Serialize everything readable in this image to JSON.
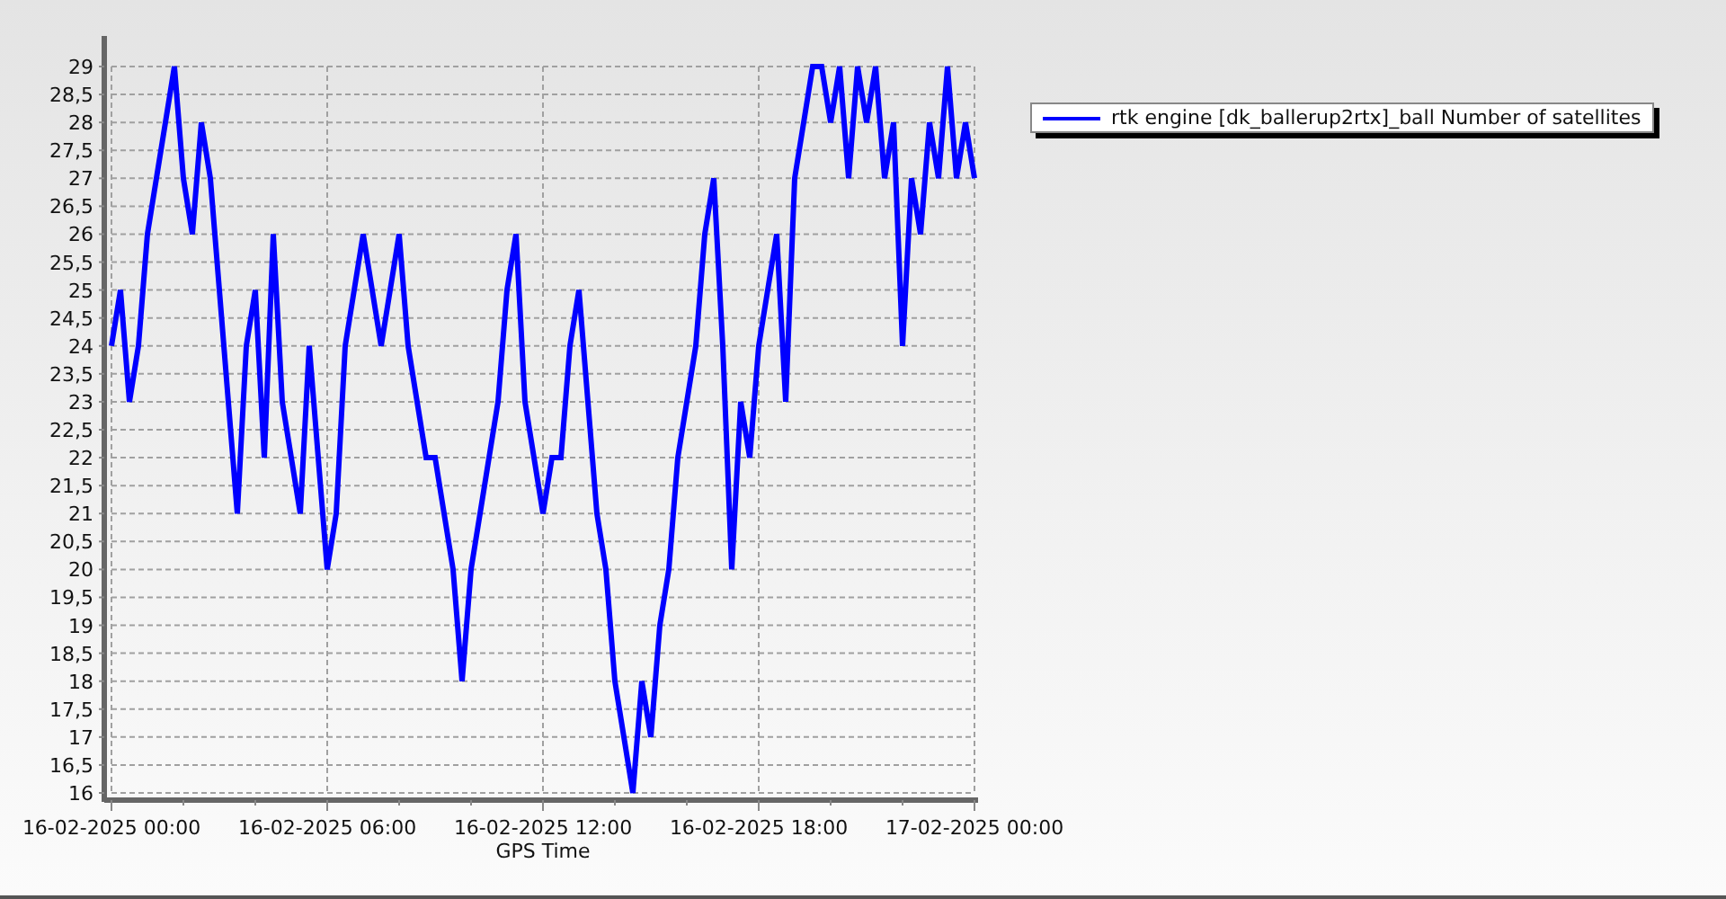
{
  "chart": {
    "chart_data": {
      "type": "line",
      "xlabel": "GPS Time",
      "ylim": [
        16,
        29
      ],
      "grid": true,
      "categories": [
        "16-02-2025 00:00",
        null,
        null,
        null,
        null,
        null,
        null,
        null,
        null,
        null,
        null,
        null,
        null,
        null,
        null,
        null,
        null,
        null,
        null,
        null,
        null,
        null,
        null,
        null,
        "16-02-2025 06:00",
        null,
        null,
        null,
        null,
        null,
        null,
        null,
        null,
        null,
        null,
        null,
        null,
        null,
        null,
        null,
        null,
        null,
        null,
        null,
        null,
        null,
        null,
        null,
        "16-02-2025 12:00",
        null,
        null,
        null,
        null,
        null,
        null,
        null,
        null,
        null,
        null,
        null,
        null,
        null,
        null,
        null,
        null,
        null,
        null,
        null,
        null,
        null,
        null,
        null,
        "16-02-2025 18:00",
        null,
        null,
        null,
        null,
        null,
        null,
        null,
        null,
        null,
        null,
        null,
        null,
        null,
        null,
        null,
        null,
        null,
        null,
        null,
        null,
        null,
        null,
        null,
        "17-02-2025 00:00"
      ],
      "yticks": [
        16,
        {
          "value": 16.5,
          "label": "16,5"
        },
        17,
        {
          "value": 17.5,
          "label": "17,5"
        },
        18,
        {
          "value": 18.5,
          "label": "18,5"
        },
        19,
        {
          "value": 19.5,
          "label": "19,5"
        },
        20,
        {
          "value": 20.5,
          "label": "20,5"
        },
        21,
        {
          "value": 21.5,
          "label": "21,5"
        },
        22,
        {
          "value": 22.5,
          "label": "22,5"
        },
        23,
        {
          "value": 23.5,
          "label": "23,5"
        },
        24,
        {
          "value": 24.5,
          "label": "24,5"
        },
        25,
        {
          "value": 25.5,
          "label": "25,5"
        },
        26,
        {
          "value": 26.5,
          "label": "26,5"
        },
        27,
        {
          "value": 27.5,
          "label": "27,5"
        },
        28,
        {
          "value": 28.5,
          "label": "28,5"
        },
        29
      ],
      "series": [
        {
          "name": "rtk engine [dk_ballerup2rtx]_ball Number of satellites",
          "color": "#0000ff",
          "values": [
            24,
            25,
            23,
            24,
            26,
            27,
            28,
            29,
            27,
            26,
            28,
            27,
            25,
            23,
            21,
            24,
            25,
            22,
            26,
            23,
            22,
            21,
            24,
            22,
            20,
            21,
            24,
            25,
            26,
            25,
            24,
            25,
            26,
            24,
            23,
            22,
            22,
            21,
            20,
            18,
            20,
            21,
            22,
            23,
            25,
            26,
            23,
            22,
            21,
            22,
            22,
            24,
            25,
            23,
            21,
            20,
            18,
            17,
            16,
            18,
            17,
            19,
            20,
            22,
            23,
            24,
            26,
            27,
            24,
            20,
            23,
            22,
            24,
            25,
            26,
            23,
            27,
            28,
            29,
            29,
            28,
            29,
            27,
            29,
            28,
            29,
            27,
            28,
            24,
            27,
            26,
            28,
            27,
            29,
            27,
            28,
            27
          ]
        }
      ]
    }
  }
}
